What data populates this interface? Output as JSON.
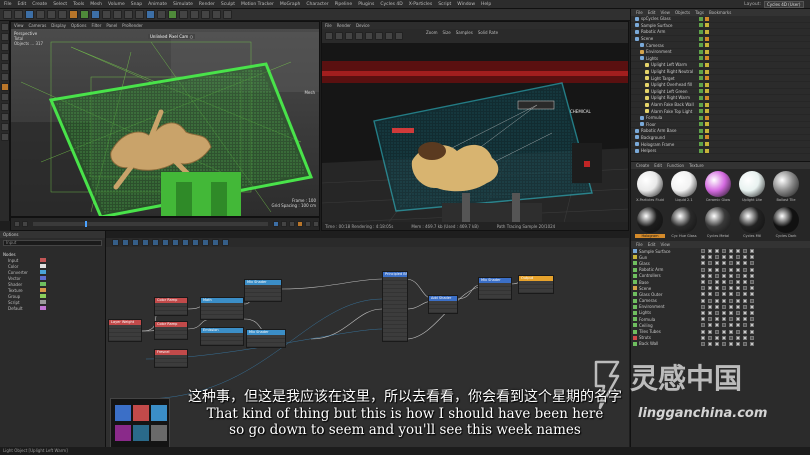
{
  "menubar": {
    "items": [
      "File",
      "Edit",
      "Create",
      "Select",
      "Tools",
      "Mesh",
      "Volume",
      "Snap",
      "Animate",
      "Simulate",
      "Render",
      "Sculpt",
      "Motion Tracker",
      "MoGraph",
      "Character",
      "Pipeline",
      "Plugins",
      "Cycles 4D",
      "X-Particles",
      "Script",
      "Window",
      "Help"
    ],
    "layout_label": "Layout:",
    "layout_value": "Cycles 4D (User)"
  },
  "viewport1": {
    "menu": [
      "View",
      "Cameras",
      "Display",
      "Options",
      "Filter",
      "Panel",
      "ProRender"
    ],
    "camera_label": "Perspective",
    "hud_lines": [
      "Total",
      "Objects  ...  317"
    ],
    "cam_tag": "Unlinked Pixel Cam ○",
    "grid_label": "Grid Spacing : 100 cm",
    "frame_label": "Frame : 100",
    "side_label": "Mesh"
  },
  "viewport2": {
    "menu": [
      "File",
      "Render",
      "Device"
    ],
    "fields": [
      "Zoom",
      "Size",
      "Samples",
      "Solid Rate"
    ],
    "status": [
      "Time : 00:18  Rendering : 4:18:05s",
      "Mem : 469.7 kb  (Used : 469.7 kB)",
      "Path Tracing Sample 20/1024"
    ],
    "badge": "CHEMICAL"
  },
  "objmgr": {
    "menu": [
      "File",
      "Edit",
      "View",
      "Objects",
      "Tags",
      "Bookmarks"
    ],
    "rows": [
      {
        "name": "spCycles Glass",
        "color": "#7aa9d8",
        "sel": false
      },
      {
        "name": "Sample Surface",
        "color": "#7aa9d8",
        "sel": false
      },
      {
        "name": "Robotic Arm",
        "color": "#7aa9d8",
        "sel": false
      },
      {
        "name": "Scene",
        "color": "#7aa9d8",
        "sel": false
      },
      {
        "name": "Cameras",
        "color": "#7aa9d8",
        "sel": false
      },
      {
        "name": "Environment",
        "color": "#d4a34a",
        "sel": false
      },
      {
        "name": "Lights",
        "color": "#7aa9d8",
        "sel": false
      },
      {
        "name": "Uplight Left Warm",
        "color": "#e4d36a",
        "sel": false
      },
      {
        "name": "Uplight Right Neutral",
        "color": "#e4d36a",
        "sel": false
      },
      {
        "name": "Light Target",
        "color": "#e4d36a",
        "sel": false
      },
      {
        "name": "Uplight Overhead fill",
        "color": "#e4d36a",
        "sel": false
      },
      {
        "name": "Uplight Left Green",
        "color": "#e4d36a",
        "sel": false
      },
      {
        "name": "Uplight Right Warm",
        "color": "#e4d36a",
        "sel": false
      },
      {
        "name": "Alarm Fake Back Wall",
        "color": "#e4d36a",
        "sel": false
      },
      {
        "name": "Alarm Fake Top Light",
        "color": "#e4d36a",
        "sel": false
      },
      {
        "name": "Formula",
        "color": "#7aa9d8",
        "sel": false
      },
      {
        "name": "Floor",
        "color": "#7aa9d8",
        "sel": false
      },
      {
        "name": "Robotic Arm Base",
        "color": "#7aa9d8",
        "sel": false
      },
      {
        "name": "Background",
        "color": "#7aa9d8",
        "sel": false
      },
      {
        "name": "Hologram Frame",
        "color": "#7aa9d8",
        "sel": false
      },
      {
        "name": "Helpers",
        "color": "#7aa9d8",
        "sel": false
      }
    ]
  },
  "matmgr": {
    "menu": [
      "Create",
      "Edit",
      "Function",
      "Texture"
    ],
    "materials": [
      {
        "name": "X-Particles Fluid",
        "color": "#e9e9e9",
        "sel": false
      },
      {
        "name": "Liquid 2.1",
        "color": "#f2f2f2",
        "sel": false
      },
      {
        "name": "Ceramic Glow",
        "color": "#d46ae0",
        "sel": false
      },
      {
        "name": "Uplight Lite",
        "color": "#e8f2f0",
        "sel": false
      },
      {
        "name": "Ballast Tile",
        "color": "#8a8a8a",
        "sel": false
      },
      {
        "name": "Hologram",
        "color": "#1c1c1c",
        "sel": true
      },
      {
        "name": "Cyc Hue Glass",
        "color": "#2a2a2a",
        "sel": false
      },
      {
        "name": "Cycles Metal",
        "color": "#3a3a3a",
        "sel": false
      },
      {
        "name": "Cycles Mtl",
        "color": "#222222",
        "sel": false
      },
      {
        "name": "Cycles Dark",
        "color": "#111111",
        "sel": false
      }
    ]
  },
  "nodelist": {
    "title": "Options",
    "search_placeholder": "Input",
    "section": "Nodes",
    "rows": [
      {
        "name": "Input",
        "color": "#c25656"
      },
      {
        "name": "Color",
        "color": "#e0e0e0"
      },
      {
        "name": "Converter",
        "color": "#4aa4d8"
      },
      {
        "name": "Vector",
        "color": "#5f6fd0"
      },
      {
        "name": "Shader",
        "color": "#6fbf5f"
      },
      {
        "name": "Texture",
        "color": "#d8984a"
      },
      {
        "name": "Group",
        "color": "#8ccf5c"
      },
      {
        "name": "Script",
        "color": "#9a9a9a"
      },
      {
        "name": "Default",
        "color": "#c277d4"
      }
    ]
  },
  "nodeeditor": {
    "nodes": [
      {
        "title": "Layer Weight",
        "color": "#c24a4a",
        "ports": 4
      },
      {
        "title": "Color Ramp",
        "color": "#c24a4a",
        "ports": 3
      },
      {
        "title": "Color Ramp",
        "color": "#c24a4a",
        "ports": 3
      },
      {
        "title": "Fresnel",
        "color": "#c24a4a",
        "ports": 3
      },
      {
        "title": "Math",
        "color": "#3b8ec7",
        "ports": 4
      },
      {
        "title": "Emission",
        "color": "#3b8ec7",
        "ports": 3
      },
      {
        "title": "Mix Shader",
        "color": "#3b8ec7",
        "ports": 4
      },
      {
        "title": "Mix Shader",
        "color": "#3b8ec7",
        "ports": 3
      },
      {
        "title": "Principled BSDF",
        "color": "#3b6fc7",
        "ports": 16
      },
      {
        "title": "Add Shader",
        "color": "#3b6fc7",
        "ports": 3
      },
      {
        "title": "Mix Shader",
        "color": "#3b6fc7",
        "ports": 4
      },
      {
        "title": "Output",
        "color": "#e6a22c",
        "ports": 3
      }
    ]
  },
  "layers": {
    "menu": [
      "File",
      "Edit",
      "View"
    ],
    "rows": [
      {
        "name": "Sample Surface",
        "color": "#7aa9d8"
      },
      {
        "name": "Gun",
        "color": "#c7b339"
      },
      {
        "name": "Glass",
        "color": "#6fbf5f"
      },
      {
        "name": "Robotic Arm",
        "color": "#6fbf5f"
      },
      {
        "name": "Controllers",
        "color": "#6fbf5f"
      },
      {
        "name": "Base",
        "color": "#6fbf5f"
      },
      {
        "name": "Scene",
        "color": "#d4a34a"
      },
      {
        "name": "Glass Outer",
        "color": "#6fbf5f"
      },
      {
        "name": "Cameras",
        "color": "#6fbf5f"
      },
      {
        "name": "Environment",
        "color": "#6fbf5f"
      },
      {
        "name": "Lights",
        "color": "#6fbf5f"
      },
      {
        "name": "Formula",
        "color": "#6fbf5f"
      },
      {
        "name": "Ceiling",
        "color": "#6fbf5f"
      },
      {
        "name": "Tiles Tubes",
        "color": "#6fbf5f"
      },
      {
        "name": "Struts",
        "color": "#d04a4a"
      },
      {
        "name": "Back Wall",
        "color": "#6fbf5f"
      }
    ]
  },
  "subtitles": {
    "chinese": "这种事，但这是我应该在这里，所以去看看，你会看到这个星期的名字",
    "english_line1": "That kind of thing but this is how I should have been here",
    "english_line2": "so go down to seem and you'll see this week names"
  },
  "watermark": {
    "text_cn": "灵感中国",
    "url": "lingganchina.com"
  },
  "statusbar": {
    "text": "Light Object [Uplight Left Warm]"
  },
  "colors": {
    "accent": "#4ca3ff",
    "hologram_green": "#49e34a",
    "render_bg": "#1a1a1a",
    "selected_material": "#d48a2a"
  }
}
